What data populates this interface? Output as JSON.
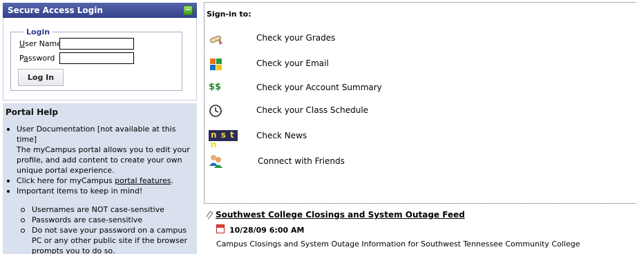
{
  "login_panel": {
    "header": "Secure Access Login",
    "collapse_symbol": "−",
    "legend": "Login",
    "username_label_u": "U",
    "username_label_rest": "ser Name",
    "password_label_u": "a",
    "password_label_pre": "P",
    "password_label_rest": "ssword",
    "username_value": "",
    "password_value": "",
    "login_button": "Log In"
  },
  "portal_help": {
    "title": "Portal Help",
    "items": [
      "User Documentation [not available at this time]",
      "The myCampus portal allows you to edit your profile, and add content to create your own unique portal experience.",
      "Click here for myCampus ",
      "Important items to keep in mind!"
    ],
    "features_link": "portal features",
    "features_after": ".",
    "sub_items": [
      "Usernames are NOT case-sensitive",
      "Passwords are case-sensitive",
      "Do not save your password on a campus PC or any other public site if the browser prompts you to do so."
    ]
  },
  "signin": {
    "title": "Sign-in to:",
    "links": [
      {
        "label": "Check your Grades",
        "icon": "diploma-icon"
      },
      {
        "label": "Check your Email",
        "icon": "email-icon"
      },
      {
        "label": "Check your Account Summary",
        "icon": "money-icon",
        "icon_text": "$$"
      },
      {
        "label": "Check your Class Schedule",
        "icon": "clock-icon"
      },
      {
        "label": "Check News",
        "icon": "news-icon",
        "icon_text": "n s t n"
      },
      {
        "label": "Connect with Friends",
        "icon": "friends-icon"
      }
    ]
  },
  "feed": {
    "title": "Southwest College Closings and System Outage Feed",
    "date": "10/28/09 6:00 AM",
    "description": "Campus Closings and System Outage Information for Southwest Tennessee Community College"
  }
}
